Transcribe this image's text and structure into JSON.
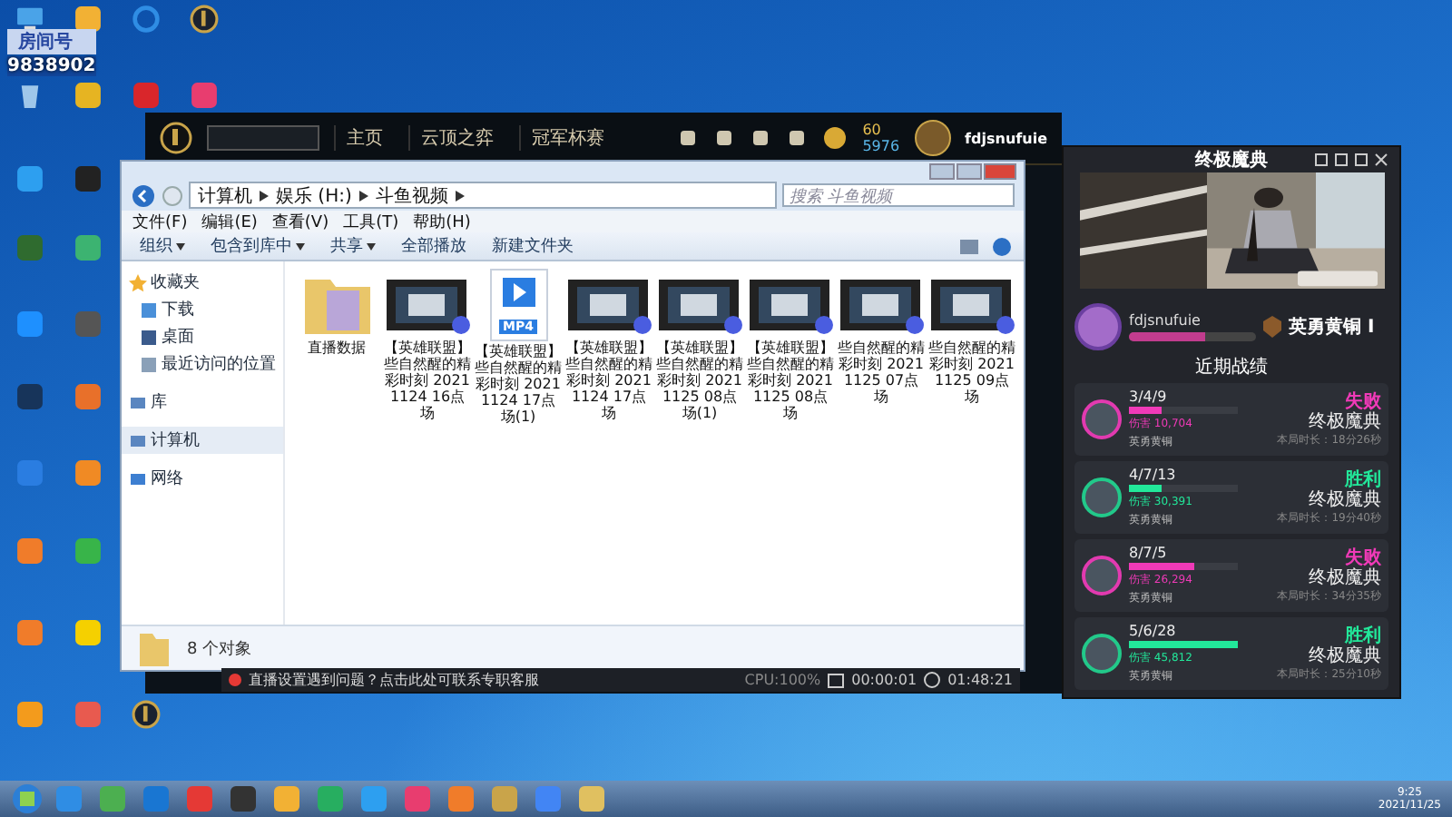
{
  "overlay": {
    "room_label": "房间号",
    "room_number": "9838902"
  },
  "game_client": {
    "nav": [
      "主页",
      "云顶之弈",
      "冠军杯赛"
    ],
    "currency": [
      "60",
      "5976"
    ],
    "username": "fdjsnufuie"
  },
  "explorer": {
    "breadcrumb": [
      "计算机",
      "娱乐 (H:)",
      "斗鱼视频"
    ],
    "search": {
      "placeholder": "搜索 斗鱼视频"
    },
    "menu": [
      "文件(F)",
      "编辑(E)",
      "查看(V)",
      "工具(T)",
      "帮助(H)"
    ],
    "toolbar": [
      {
        "label": "组织",
        "dropdown": true
      },
      {
        "label": "包含到库中",
        "dropdown": true
      },
      {
        "label": "共享",
        "dropdown": true
      },
      {
        "label": "全部播放",
        "dropdown": false
      },
      {
        "label": "新建文件夹",
        "dropdown": false
      }
    ],
    "sidebar": [
      {
        "label": "收藏夹",
        "kind": "star",
        "selected": false,
        "children": [
          {
            "label": "下载",
            "kind": "download",
            "selected": false
          },
          {
            "label": "桌面",
            "kind": "desktop",
            "selected": false
          },
          {
            "label": "最近访问的位置",
            "kind": "recent",
            "selected": false
          }
        ]
      },
      {
        "label": "库",
        "kind": "library",
        "selected": false
      },
      {
        "label": "计算机",
        "kind": "computer",
        "selected": true
      },
      {
        "label": "网络",
        "kind": "network",
        "selected": false
      }
    ],
    "files": [
      {
        "name": "直播数据",
        "kind": "folder"
      },
      {
        "name": "【英雄联盟】些自然醒的精彩时刻 20211124 16点场",
        "kind": "video"
      },
      {
        "name": "【英雄联盟】些自然醒的精彩时刻 20211124 17点场(1)",
        "kind": "mp4",
        "badge": "MP4"
      },
      {
        "name": "【英雄联盟】些自然醒的精彩时刻 20211124 17点场",
        "kind": "video"
      },
      {
        "name": "【英雄联盟】些自然醒的精彩时刻 20211125 08点场(1)",
        "kind": "video"
      },
      {
        "name": "【英雄联盟】些自然醒的精彩时刻 20211125 08点场",
        "kind": "video"
      },
      {
        "name": "些自然醒的精彩时刻 20211125 07点场",
        "kind": "video"
      },
      {
        "name": "些自然醒的精彩时刻 20211125 09点场",
        "kind": "video"
      }
    ],
    "status": "8 个对象"
  },
  "stream_bar": {
    "message": "直播设置遇到问题？点击此处可联系专职客服",
    "cpu": "CPU:100%",
    "elapsed": "00:00:01",
    "clock": "01:48:21"
  },
  "side_panel": {
    "title": "终极魔典",
    "player": {
      "name": "fdjsnufuie",
      "level": 0.6
    },
    "rank": "英勇黄铜 I",
    "section": "近期战绩",
    "matches": [
      {
        "kda": "3/4/9",
        "damage": "伤害 10,704",
        "level": 0.3,
        "rank": "英勇黄铜",
        "won": false,
        "result": "失败",
        "mode": "终极魔典",
        "duration": "本局时长：18分26秒"
      },
      {
        "kda": "4/7/13",
        "damage": "伤害 30,391",
        "level": 0.3,
        "rank": "英勇黄铜",
        "won": true,
        "result": "胜利",
        "mode": "终极魔典",
        "duration": "本局时长：19分40秒"
      },
      {
        "kda": "8/7/5",
        "damage": "伤害 26,294",
        "level": 0.6,
        "rank": "英勇黄铜",
        "won": false,
        "result": "失败",
        "mode": "终极魔典",
        "duration": "本局时长：34分35秒"
      },
      {
        "kda": "5/6/28",
        "damage": "伤害 45,812",
        "level": 1.0,
        "rank": "英勇黄铜",
        "won": true,
        "result": "胜利",
        "mode": "终极魔典",
        "duration": "本局时长：25分10秒"
      }
    ]
  },
  "taskbar": {
    "time": "9:25",
    "date": "2021/11/25"
  }
}
